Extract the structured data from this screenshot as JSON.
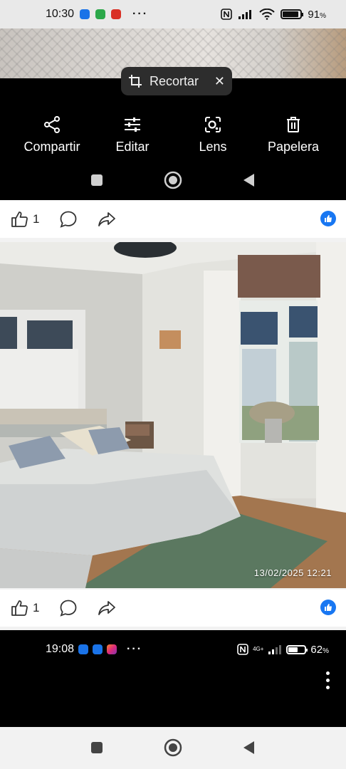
{
  "status_bar": {
    "time": "10:30",
    "dots": "···",
    "battery_percent": "91",
    "battery_level": 0.91,
    "battery_suffix": "%"
  },
  "crop_chip": {
    "label": "Recortar",
    "close": "✕"
  },
  "actions": [
    {
      "label": "Compartir",
      "icon": "share-icon"
    },
    {
      "label": "Editar",
      "icon": "sliders-icon"
    },
    {
      "label": "Lens",
      "icon": "lens-icon"
    },
    {
      "label": "Papelera",
      "icon": "trash-icon"
    }
  ],
  "post_1": {
    "like_count": "1"
  },
  "photo": {
    "timestamp": "13/02/2025  12:21"
  },
  "post_2": {
    "like_count": "1"
  },
  "second_status_bar": {
    "time": "19:08",
    "dots": "···",
    "network": "4G+",
    "battery_percent": "62",
    "battery_level": 0.62,
    "battery_suffix": "%"
  },
  "colors": {
    "accent": "#1877f2",
    "panel": "#000000",
    "chip": "#2d2d2d"
  }
}
